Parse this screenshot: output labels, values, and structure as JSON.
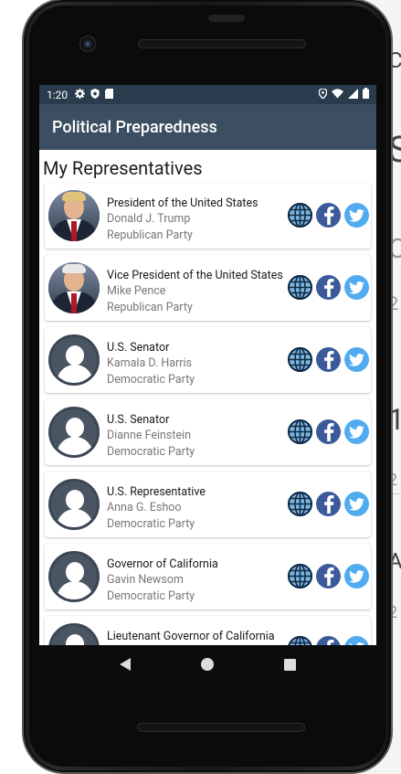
{
  "status_bar": {
    "time": "1:20",
    "left_icons": [
      "settings-icon",
      "shield-icon",
      "sim-icon"
    ],
    "right_icons": [
      "location-icon",
      "wifi-icon",
      "signal-icon",
      "battery-icon"
    ]
  },
  "app": {
    "title": "Political Preparedness"
  },
  "main": {
    "section_title": "My Representatives",
    "representatives": [
      {
        "office": "President of the United States",
        "name": "Donald J. Trump",
        "party": "Republican Party",
        "avatar": "photo"
      },
      {
        "office": "Vice President of the United States",
        "name": "Mike Pence",
        "party": "Republican Party",
        "avatar": "photo"
      },
      {
        "office": "U.S. Senator",
        "name": "Kamala D. Harris",
        "party": "Democratic Party",
        "avatar": "generic"
      },
      {
        "office": "U.S. Senator",
        "name": "Dianne Feinstein",
        "party": "Democratic Party",
        "avatar": "generic"
      },
      {
        "office": "U.S. Representative",
        "name": "Anna G. Eshoo",
        "party": "Democratic Party",
        "avatar": "generic"
      },
      {
        "office": "Governor of California",
        "name": "Gavin Newsom",
        "party": "Democratic Party",
        "avatar": "generic"
      },
      {
        "office": "Lieutenant Governor of California",
        "name": "",
        "party": "",
        "avatar": "generic"
      }
    ]
  },
  "colors": {
    "status_bar": "#2a3b4d",
    "app_bar": "#3c4e61",
    "facebook": "#3b5a9a",
    "twitter": "#50abf1",
    "website": "#0e2a45"
  },
  "background_window": {
    "fragments": [
      "C",
      "S",
      "C",
      "2",
      "1",
      "2",
      "A",
      "2"
    ]
  }
}
